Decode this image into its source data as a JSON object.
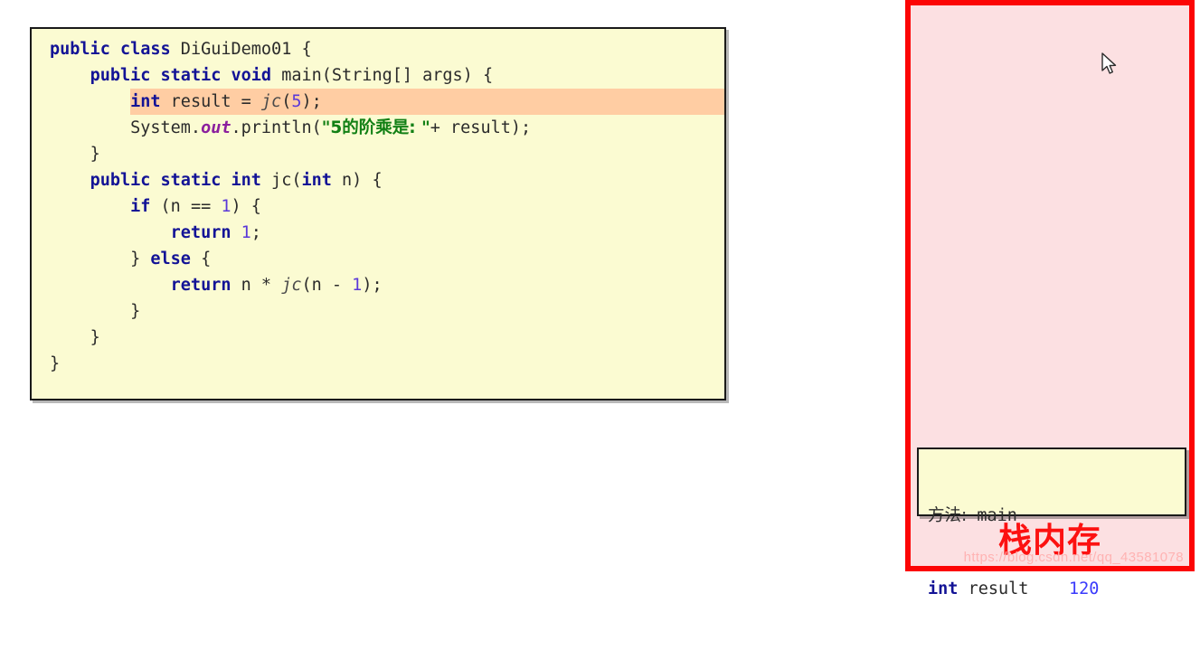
{
  "code_panel": {
    "language": "java",
    "class_name": "DiGuiDemo01",
    "highlighted_line_index": 2,
    "lines": [
      {
        "indent": 0,
        "tokens": [
          {
            "t": "public",
            "c": "kw"
          },
          {
            "t": " ",
            "c": "plain"
          },
          {
            "t": "class",
            "c": "kw"
          },
          {
            "t": " DiGuiDemo01 {",
            "c": "plain"
          }
        ]
      },
      {
        "indent": 1,
        "tokens": [
          {
            "t": "public",
            "c": "kw"
          },
          {
            "t": " ",
            "c": "plain"
          },
          {
            "t": "static",
            "c": "kw"
          },
          {
            "t": " ",
            "c": "plain"
          },
          {
            "t": "void",
            "c": "kw"
          },
          {
            "t": " main(String[] args) {",
            "c": "plain"
          }
        ]
      },
      {
        "indent": 2,
        "tokens": [
          {
            "t": "int",
            "c": "typ"
          },
          {
            "t": " result = ",
            "c": "plain"
          },
          {
            "t": "jc",
            "c": "mth"
          },
          {
            "t": "(",
            "c": "plain"
          },
          {
            "t": "5",
            "c": "num"
          },
          {
            "t": ");",
            "c": "plain"
          }
        ]
      },
      {
        "indent": 2,
        "tokens": [
          {
            "t": "System.",
            "c": "plain"
          },
          {
            "t": "out",
            "c": "fld"
          },
          {
            "t": ".println(",
            "c": "plain"
          },
          {
            "t": "\"5的阶乘是: \"",
            "c": "str"
          },
          {
            "t": "+ result);",
            "c": "plain"
          }
        ]
      },
      {
        "indent": 1,
        "tokens": [
          {
            "t": "}",
            "c": "plain"
          }
        ]
      },
      {
        "indent": 1,
        "tokens": [
          {
            "t": "public",
            "c": "kw"
          },
          {
            "t": " ",
            "c": "plain"
          },
          {
            "t": "static",
            "c": "kw"
          },
          {
            "t": " ",
            "c": "plain"
          },
          {
            "t": "int",
            "c": "kw"
          },
          {
            "t": " jc(",
            "c": "plain"
          },
          {
            "t": "int",
            "c": "kw"
          },
          {
            "t": " n) {",
            "c": "plain"
          }
        ]
      },
      {
        "indent": 2,
        "tokens": [
          {
            "t": "if",
            "c": "kw"
          },
          {
            "t": " (n == ",
            "c": "plain"
          },
          {
            "t": "1",
            "c": "num"
          },
          {
            "t": ") {",
            "c": "plain"
          }
        ]
      },
      {
        "indent": 3,
        "tokens": [
          {
            "t": "return",
            "c": "kw"
          },
          {
            "t": " ",
            "c": "plain"
          },
          {
            "t": "1",
            "c": "num"
          },
          {
            "t": ";",
            "c": "plain"
          }
        ]
      },
      {
        "indent": 2,
        "tokens": [
          {
            "t": "} ",
            "c": "plain"
          },
          {
            "t": "else",
            "c": "kw"
          },
          {
            "t": " {",
            "c": "plain"
          }
        ]
      },
      {
        "indent": 3,
        "tokens": [
          {
            "t": "return",
            "c": "kw"
          },
          {
            "t": " n * ",
            "c": "plain"
          },
          {
            "t": "jc",
            "c": "mth"
          },
          {
            "t": "(n - ",
            "c": "plain"
          },
          {
            "t": "1",
            "c": "num"
          },
          {
            "t": ");",
            "c": "plain"
          }
        ]
      },
      {
        "indent": 2,
        "tokens": [
          {
            "t": "}",
            "c": "plain"
          }
        ]
      },
      {
        "indent": 1,
        "tokens": [
          {
            "t": "}",
            "c": "plain"
          }
        ]
      },
      {
        "indent": 0,
        "tokens": [
          {
            "t": "}",
            "c": "plain"
          }
        ]
      }
    ]
  },
  "stack_panel": {
    "title": "栈内存",
    "frames": [
      {
        "method_label": "方法:",
        "method_name": "main",
        "var_type": "int",
        "var_name": "result",
        "var_value": "120"
      }
    ],
    "cursor_icon": "mouse-pointer-icon",
    "watermark": "https://blog.csdn.net/qq_43581078"
  },
  "colors": {
    "code_bg": "#fbfbd2",
    "code_border": "#1a1a1a",
    "highlight": "#ffcda3",
    "keyword": "#131396",
    "number": "#5a38d8",
    "string": "#128015",
    "field": "#8b1f9e",
    "stack_bg": "#fce0e2",
    "stack_border": "#fc0505",
    "stack_title": "#fc1111",
    "value": "#3a3afc",
    "watermark": "#ffb3b3"
  }
}
